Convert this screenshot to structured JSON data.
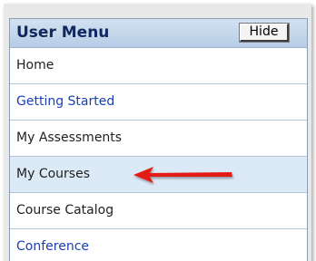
{
  "menu": {
    "title": "User Menu",
    "hide_label": "Hide",
    "items": [
      {
        "label": "Home",
        "link": false,
        "highlight": false
      },
      {
        "label": "Getting Started",
        "link": true,
        "highlight": false
      },
      {
        "label": "My Assessments",
        "link": false,
        "highlight": false
      },
      {
        "label": "My Courses",
        "link": false,
        "highlight": true
      },
      {
        "label": "Course Catalog",
        "link": false,
        "highlight": false
      },
      {
        "label": "Conference",
        "link": true,
        "highlight": false
      }
    ]
  },
  "colors": {
    "header_bg": "#c3d6eb",
    "header_text": "#10285e",
    "link_text": "#1a3fb0",
    "highlight_bg": "#dce9f6",
    "arrow": "#e41b17"
  },
  "annotation": {
    "arrow_icon": "red-arrow-pointing-left",
    "target_item": "My Courses"
  }
}
